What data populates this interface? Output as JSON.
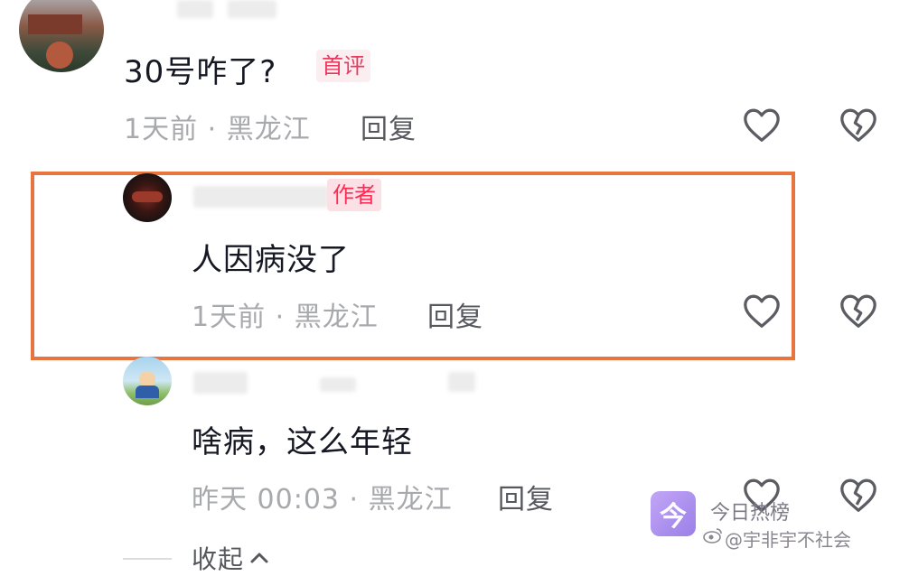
{
  "comments": [
    {
      "text": "30号咋了?",
      "badge": "首评",
      "meta": "1天前 · 黑龙江",
      "reply_label": "回复"
    },
    {
      "text": "人因病没了",
      "badge": "作者",
      "meta": "1天前 · 黑龙江",
      "reply_label": "回复"
    },
    {
      "text": "啥病，这么年轻",
      "meta": "昨天 00:03 · 黑龙江",
      "reply_label": "回复"
    }
  ],
  "collapse_label": "收起",
  "watermark": {
    "brand": "今日热榜",
    "handle": "@宇非宇不社会",
    "logo_char": "今"
  },
  "icons": {
    "like": "heart-outline-icon",
    "dislike": "broken-heart-icon",
    "collapse": "chevron-up-icon"
  },
  "colors": {
    "highlight_border": "#e8743f",
    "badge_text": "#fe2c55",
    "watermark_logo": "#a98cf0"
  }
}
